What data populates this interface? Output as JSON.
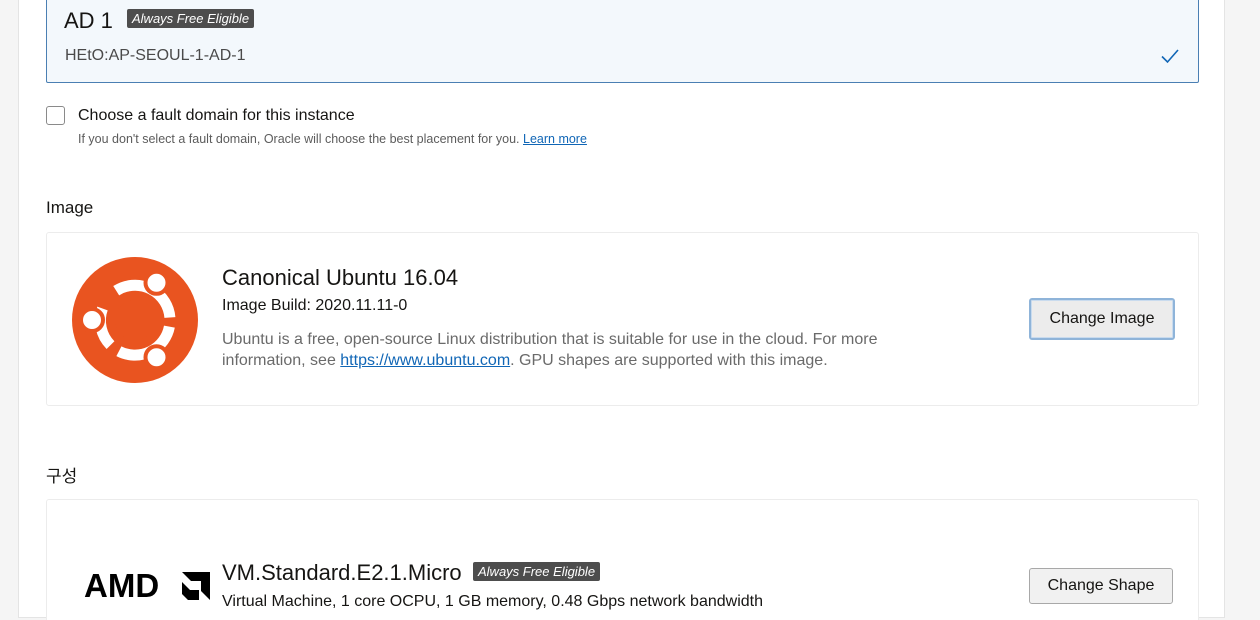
{
  "availability_domain": {
    "title": "AD 1",
    "badge": "Always Free Eligible",
    "subtitle": "HEtO:AP-SEOUL-1-AD-1",
    "selected": true
  },
  "fault_domain": {
    "checkbox_label": "Choose a fault domain for this instance",
    "checked": false,
    "help_text": "If you don't select a fault domain, Oracle will choose the best placement for you.",
    "learn_more": "Learn more"
  },
  "image_section": {
    "label": "Image",
    "name": "Canonical Ubuntu 16.04",
    "build": "Image Build: 2020.11.11-0",
    "description_before": "Ubuntu is a free, open-source Linux distribution that is suitable for use in the cloud. For more information, see ",
    "description_link": "https://www.ubuntu.com",
    "description_after": ". GPU shapes are supported with this image.",
    "change_button": "Change Image",
    "logo_icon": "ubuntu-logo-icon"
  },
  "shape_section": {
    "label": "구성",
    "name": "VM.Standard.E2.1.Micro",
    "badge": "Always Free Eligible",
    "description": "Virtual Machine, 1 core OCPU, 1 GB memory, 0.48 Gbps network bandwidth",
    "change_button": "Change Shape",
    "logo_icon": "amd-logo-icon"
  },
  "colors": {
    "selected_border": "#4a7fb3",
    "selected_bg": "#f3f8fc",
    "link": "#1066b6",
    "badge_bg": "#4d4d4d",
    "ubuntu_orange": "#e95420"
  }
}
